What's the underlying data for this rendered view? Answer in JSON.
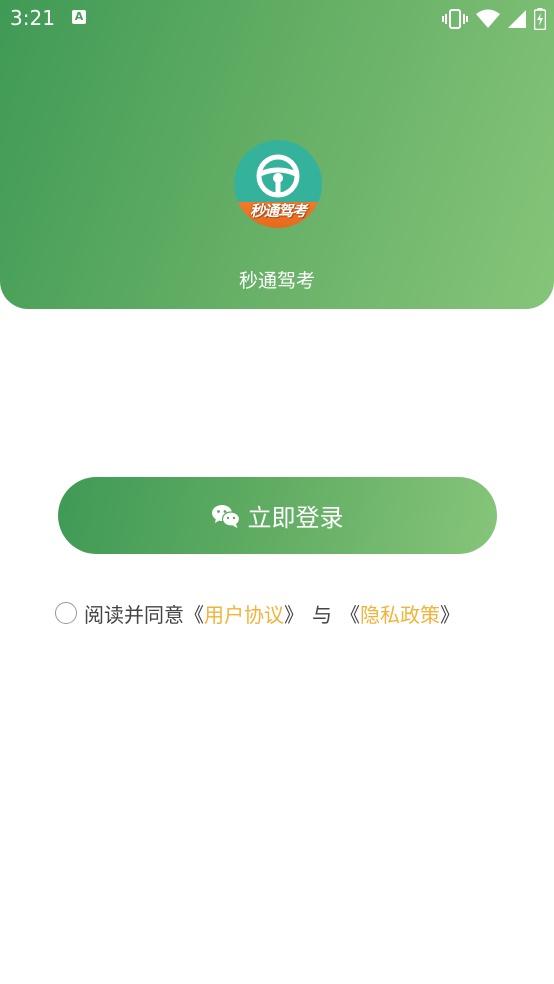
{
  "status_bar": {
    "time": "3:21",
    "notification_icon_letter": "A",
    "icons": [
      "vibrate-icon",
      "wifi-icon",
      "signal-icon",
      "battery-charging-icon"
    ]
  },
  "header": {
    "logo_text": "秒通驾考",
    "app_name": "秒通驾考",
    "gradient_start": "#3f9a55",
    "gradient_end": "#86c57a"
  },
  "login": {
    "icon": "wechat-icon",
    "label": "立即登录"
  },
  "agreement": {
    "prefix": "阅读并同意",
    "user_agreement_open": "《",
    "user_agreement": "用户协议",
    "user_agreement_close": "》",
    "conjunction": "与",
    "privacy_open": "《",
    "privacy_policy": "隐私政策",
    "privacy_close": "》",
    "link_color": "#f2b33a"
  }
}
